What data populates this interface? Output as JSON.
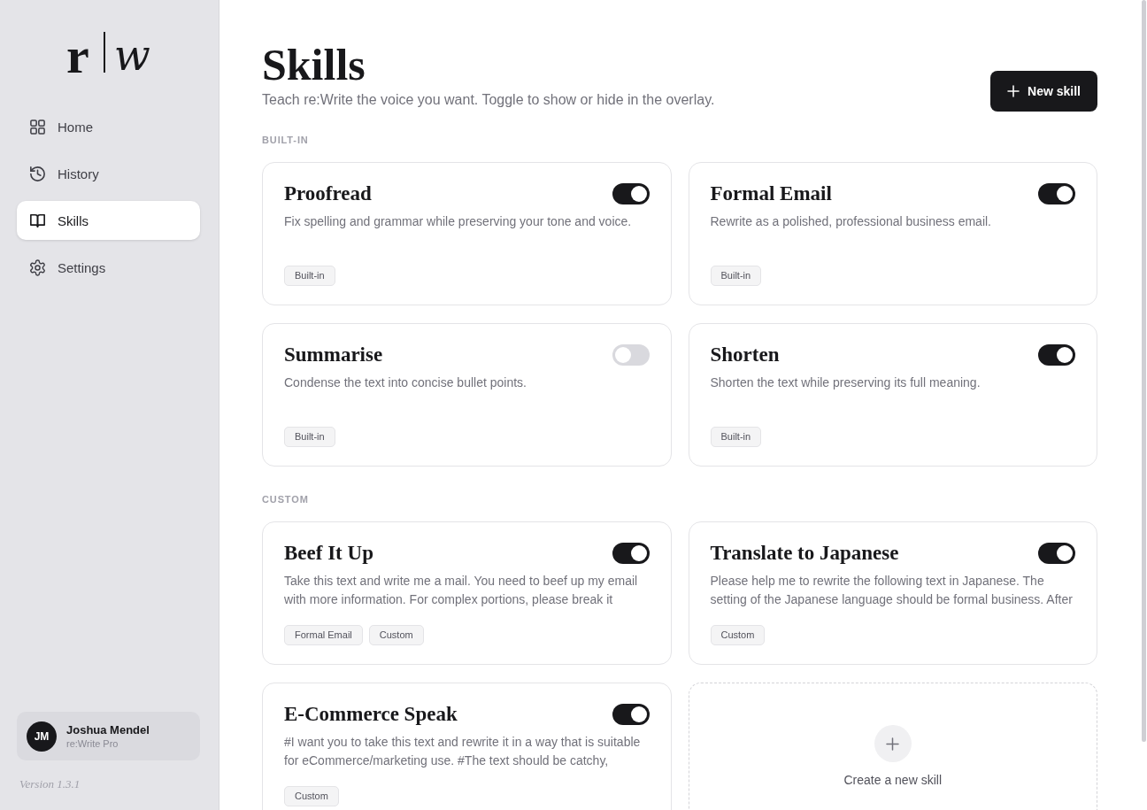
{
  "sidebar": {
    "logo": {
      "letter": "r",
      "script": "w"
    },
    "nav": [
      {
        "label": "Home",
        "selected": false
      },
      {
        "label": "History",
        "selected": false
      },
      {
        "label": "Skills",
        "selected": true
      },
      {
        "label": "Settings",
        "selected": false
      }
    ],
    "user": {
      "initials": "JM",
      "name": "Joshua Mendel",
      "plan": "re:Write Pro"
    },
    "version": "Version 1.3.1"
  },
  "header": {
    "title": "Skills",
    "subtitle": "Teach re:Write the voice you want. Toggle to show or hide in the overlay.",
    "new_button": "New skill"
  },
  "sections": [
    {
      "label": "BUILT-IN",
      "cards": [
        {
          "title": "Proofread",
          "description": "Fix spelling and grammar while preserving your tone and voice.",
          "on": true,
          "tags": [
            "Built-in"
          ]
        },
        {
          "title": "Formal Email",
          "description": "Rewrite as a polished, professional business email.",
          "on": true,
          "tags": [
            "Built-in"
          ]
        },
        {
          "title": "Summarise",
          "description": "Condense the text into concise bullet points.",
          "on": false,
          "tags": [
            "Built-in"
          ]
        },
        {
          "title": "Shorten",
          "description": "Shorten the text while preserving its full meaning.",
          "on": true,
          "tags": [
            "Built-in"
          ]
        }
      ]
    },
    {
      "label": "CUSTOM",
      "cards": [
        {
          "title": "Beef It Up",
          "description": "Take this text and write me a mail. You need to beef up my email with more information. For complex portions, please break it",
          "on": true,
          "tags": [
            "Formal Email",
            "Custom"
          ]
        },
        {
          "title": "Translate to Japanese",
          "description": "Please help me to rewrite the following text in Japanese. The setting of the Japanese language should be formal business. After",
          "on": true,
          "tags": [
            "Custom"
          ]
        },
        {
          "title": "E-Commerce Speak",
          "description": "#I want you to take this text and rewrite it in a way that is suitable for eCommerce/marketing use. #The text should be catchy,",
          "on": true,
          "tags": [
            "Custom"
          ]
        }
      ],
      "create_card": {
        "label": "Create a new skill"
      }
    }
  ]
}
